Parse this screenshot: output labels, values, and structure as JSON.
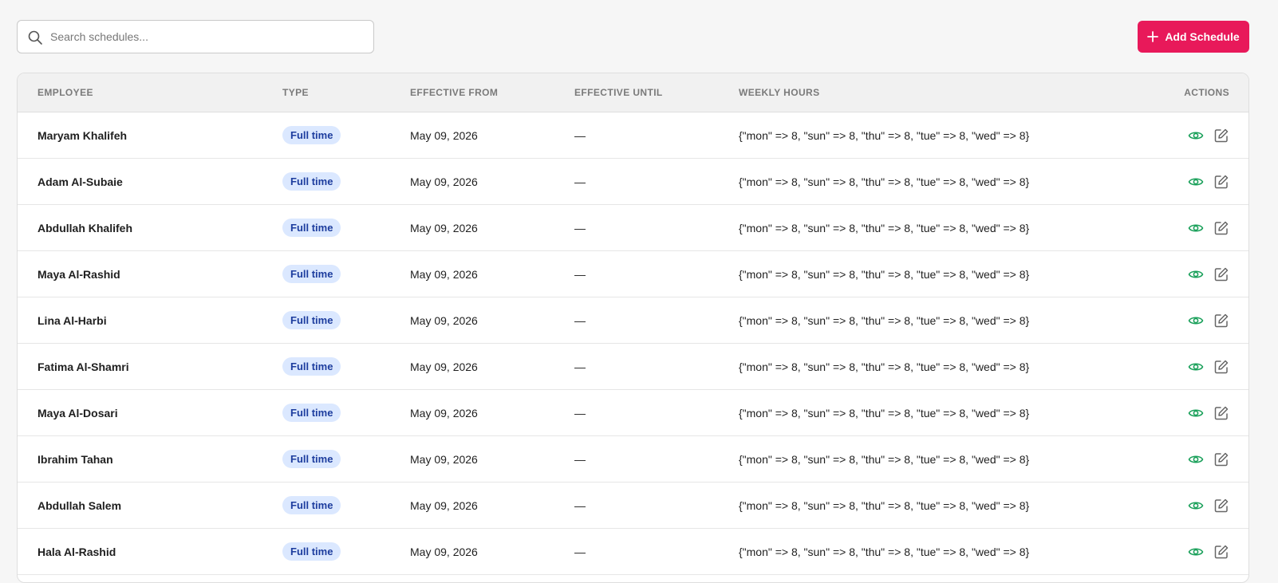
{
  "search": {
    "placeholder": "Search schedules..."
  },
  "toolbar": {
    "add_label": "Add Schedule"
  },
  "colors": {
    "accent": "#e8195a",
    "view_icon": "#1aa05a",
    "badge_bg": "#dbe8ff",
    "badge_text": "#1d3d9e"
  },
  "table": {
    "headers": {
      "employee": "EMPLOYEE",
      "type": "TYPE",
      "from": "EFFECTIVE FROM",
      "until": "EFFECTIVE UNTIL",
      "hours": "WEEKLY HOURS",
      "actions": "ACTIONS"
    },
    "rows": [
      {
        "employee": "Maryam Khalifeh",
        "type": "Full time",
        "from": "May 09, 2026",
        "until": "—",
        "hours": "{\"mon\" => 8, \"sun\" => 8, \"thu\" => 8, \"tue\" => 8, \"wed\" => 8}"
      },
      {
        "employee": "Adam Al-Subaie",
        "type": "Full time",
        "from": "May 09, 2026",
        "until": "—",
        "hours": "{\"mon\" => 8, \"sun\" => 8, \"thu\" => 8, \"tue\" => 8, \"wed\" => 8}"
      },
      {
        "employee": "Abdullah Khalifeh",
        "type": "Full time",
        "from": "May 09, 2026",
        "until": "—",
        "hours": "{\"mon\" => 8, \"sun\" => 8, \"thu\" => 8, \"tue\" => 8, \"wed\" => 8}"
      },
      {
        "employee": "Maya Al-Rashid",
        "type": "Full time",
        "from": "May 09, 2026",
        "until": "—",
        "hours": "{\"mon\" => 8, \"sun\" => 8, \"thu\" => 8, \"tue\" => 8, \"wed\" => 8}"
      },
      {
        "employee": "Lina Al-Harbi",
        "type": "Full time",
        "from": "May 09, 2026",
        "until": "—",
        "hours": "{\"mon\" => 8, \"sun\" => 8, \"thu\" => 8, \"tue\" => 8, \"wed\" => 8}"
      },
      {
        "employee": "Fatima Al-Shamri",
        "type": "Full time",
        "from": "May 09, 2026",
        "until": "—",
        "hours": "{\"mon\" => 8, \"sun\" => 8, \"thu\" => 8, \"tue\" => 8, \"wed\" => 8}"
      },
      {
        "employee": "Maya Al-Dosari",
        "type": "Full time",
        "from": "May 09, 2026",
        "until": "—",
        "hours": "{\"mon\" => 8, \"sun\" => 8, \"thu\" => 8, \"tue\" => 8, \"wed\" => 8}"
      },
      {
        "employee": "Ibrahim Tahan",
        "type": "Full time",
        "from": "May 09, 2026",
        "until": "—",
        "hours": "{\"mon\" => 8, \"sun\" => 8, \"thu\" => 8, \"tue\" => 8, \"wed\" => 8}"
      },
      {
        "employee": "Abdullah Salem",
        "type": "Full time",
        "from": "May 09, 2026",
        "until": "—",
        "hours": "{\"mon\" => 8, \"sun\" => 8, \"thu\" => 8, \"tue\" => 8, \"wed\" => 8}"
      },
      {
        "employee": "Hala Al-Rashid",
        "type": "Full time",
        "from": "May 09, 2026",
        "until": "—",
        "hours": "{\"mon\" => 8, \"sun\" => 8, \"thu\" => 8, \"tue\" => 8, \"wed\" => 8}"
      }
    ]
  }
}
